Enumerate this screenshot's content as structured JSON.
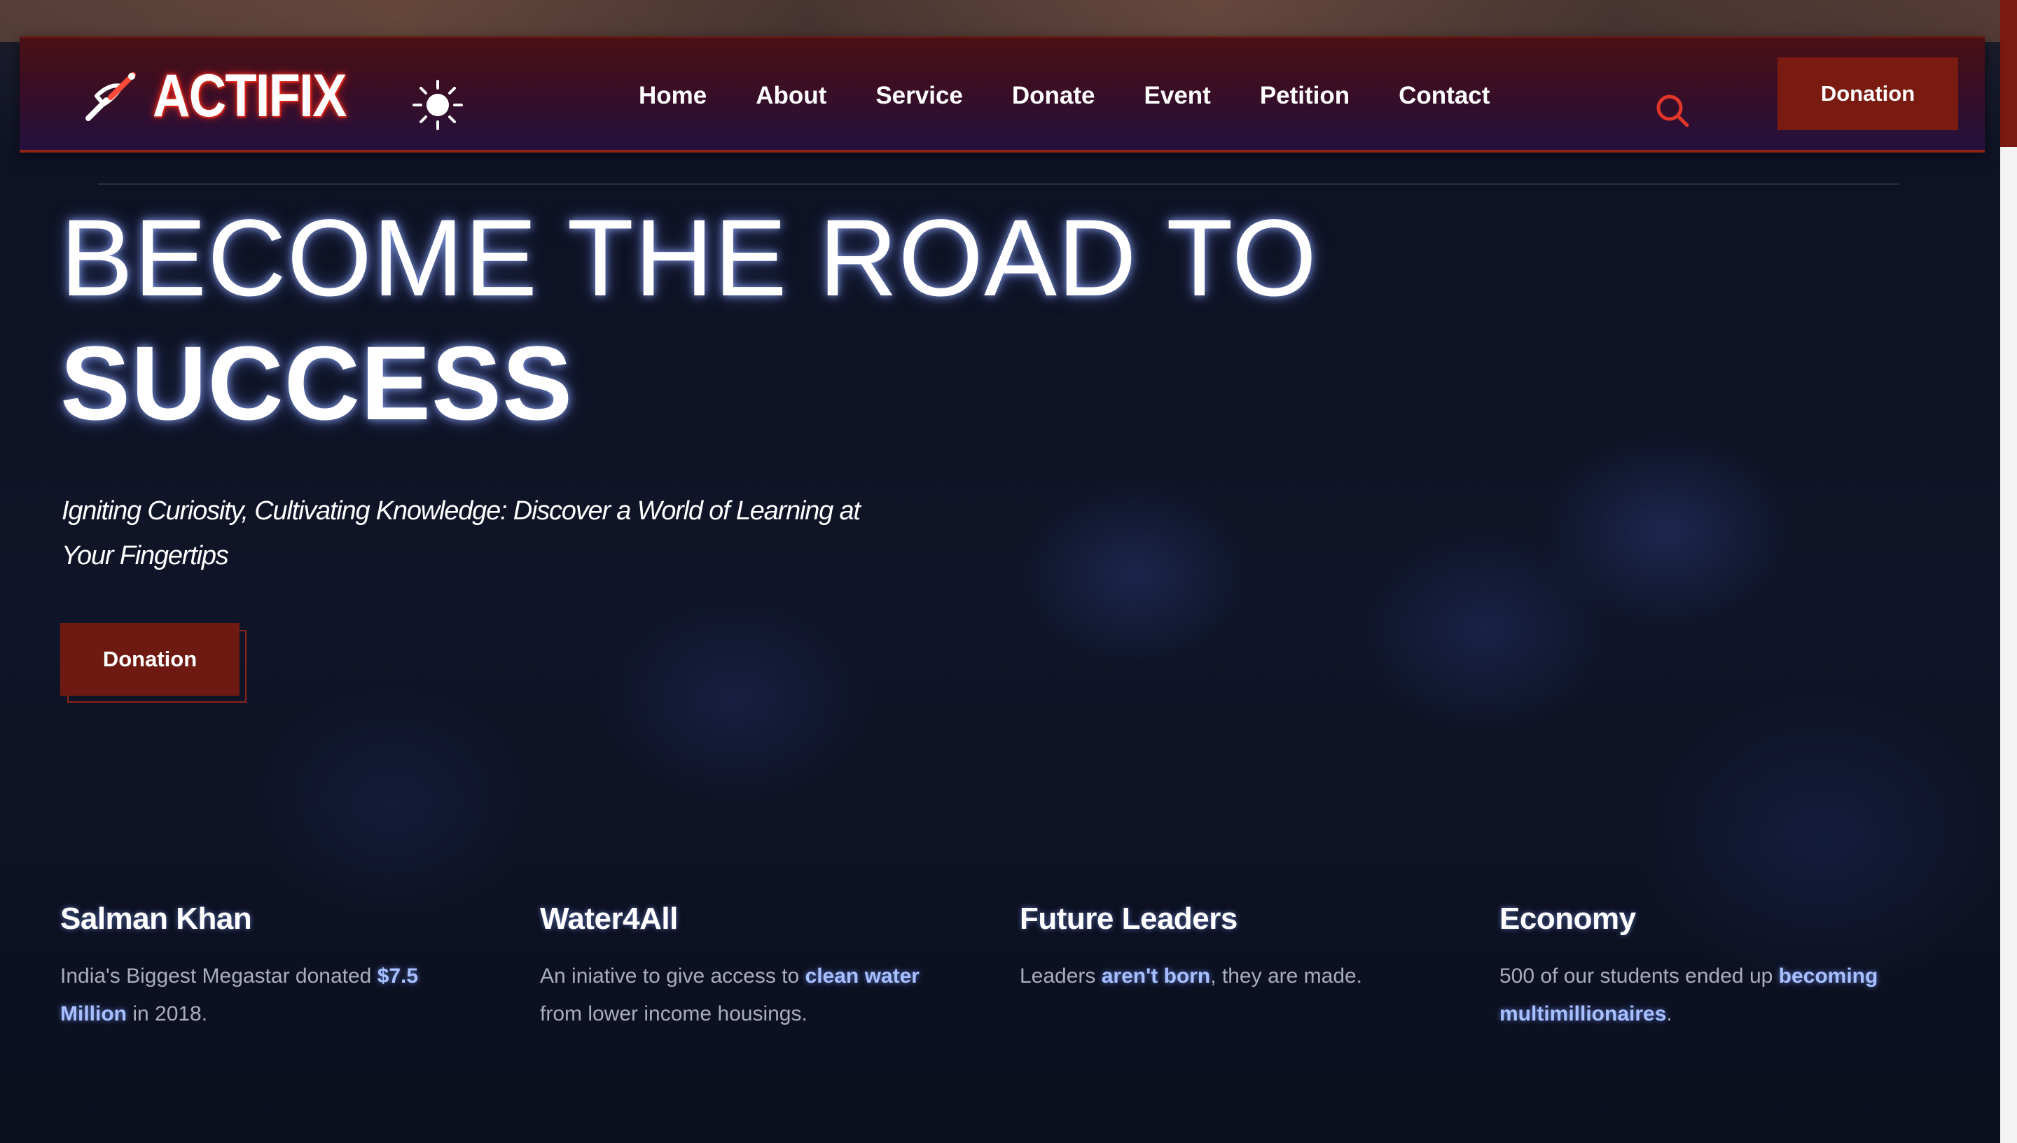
{
  "brand": {
    "logo_text": "ACTIFIX",
    "accent_color": "#7a1b12"
  },
  "nav": {
    "items": [
      "Home",
      "About",
      "Service",
      "Donate",
      "Event",
      "Petition",
      "Contact"
    ],
    "donation_label": "Donation",
    "theme_icon": "sun-icon",
    "search_icon": "search-icon"
  },
  "hero": {
    "title_line1": "BECOME THE ROAD TO",
    "title_line2": "SUCCESS",
    "subtitle_line1": "Igniting Curiosity, Cultivating Knowledge: Discover a World of Learning at",
    "subtitle_line2": "Your Fingertips",
    "donation_label": "Donation"
  },
  "features": [
    {
      "title": "Salman Khan",
      "text_before": "India's Biggest Megastar donated ",
      "highlight": "$7.5 Million",
      "text_after": " in 2018."
    },
    {
      "title": "Water4All",
      "text_before": "An iniative to give access to ",
      "highlight": "clean water",
      "text_after": " from lower income housings."
    },
    {
      "title": "Future Leaders",
      "text_before": "Leaders ",
      "highlight": "aren't born",
      "text_after": ", they are made."
    },
    {
      "title": "Economy",
      "text_before": "500 of our students ended up ",
      "highlight": "becoming multimillionaires",
      "text_after": "."
    }
  ]
}
